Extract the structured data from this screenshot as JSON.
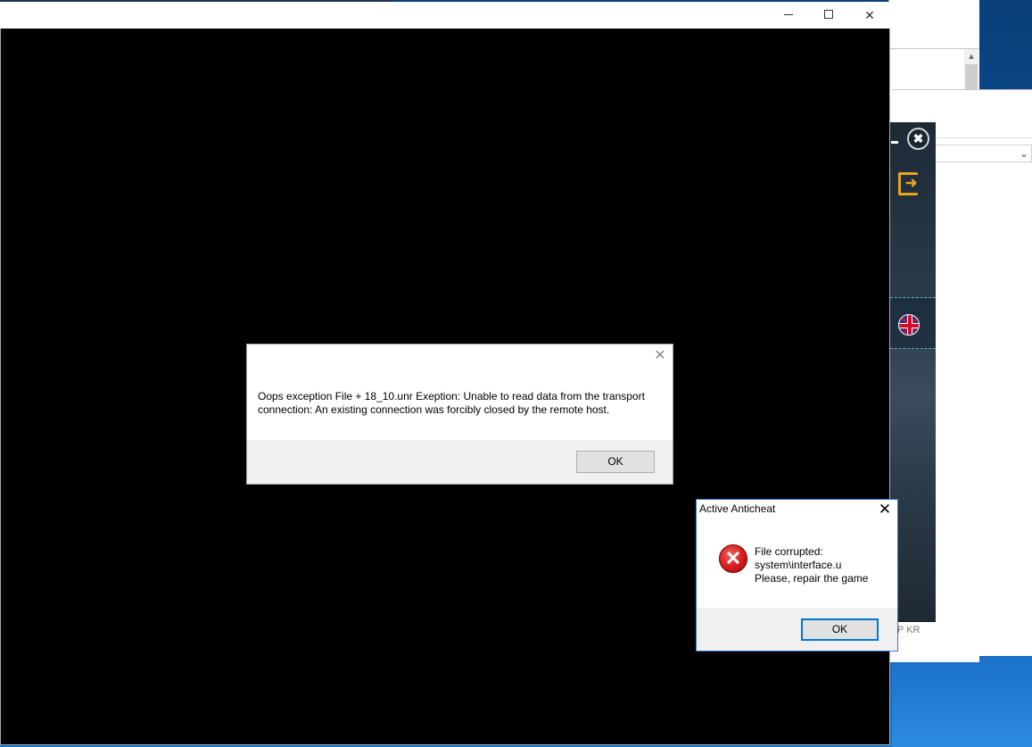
{
  "game_window": {
    "minimize_glyph": "",
    "close_glyph": "✕"
  },
  "error_dialog": {
    "close_glyph": "✕",
    "message": "Oops exception File + 18_10.unr Exeption: Unable to read data from the transport connection: An existing connection was forcibly closed by the remote host.",
    "ok_label": "OK"
  },
  "anticheat_dialog": {
    "title": "Active Anticheat",
    "close_glyph": "✕",
    "icon": "error-icon",
    "lines": [
      "File corrupted:",
      "system\\interface.u",
      "Please, repair the game"
    ],
    "ok_label": "OK"
  },
  "launcher": {
    "close_glyph": "✖",
    "exit_glyph": "➜",
    "language_icon": "uk-flag-icon",
    "footer_text": "P KR"
  },
  "background": {
    "scroll_up_glyph": "▲",
    "select_chevron_glyph": "⌄"
  },
  "colors": {
    "accent_blue": "#0078d7",
    "error_red": "#d21d1d",
    "launcher_gold": "#e7a51c"
  }
}
